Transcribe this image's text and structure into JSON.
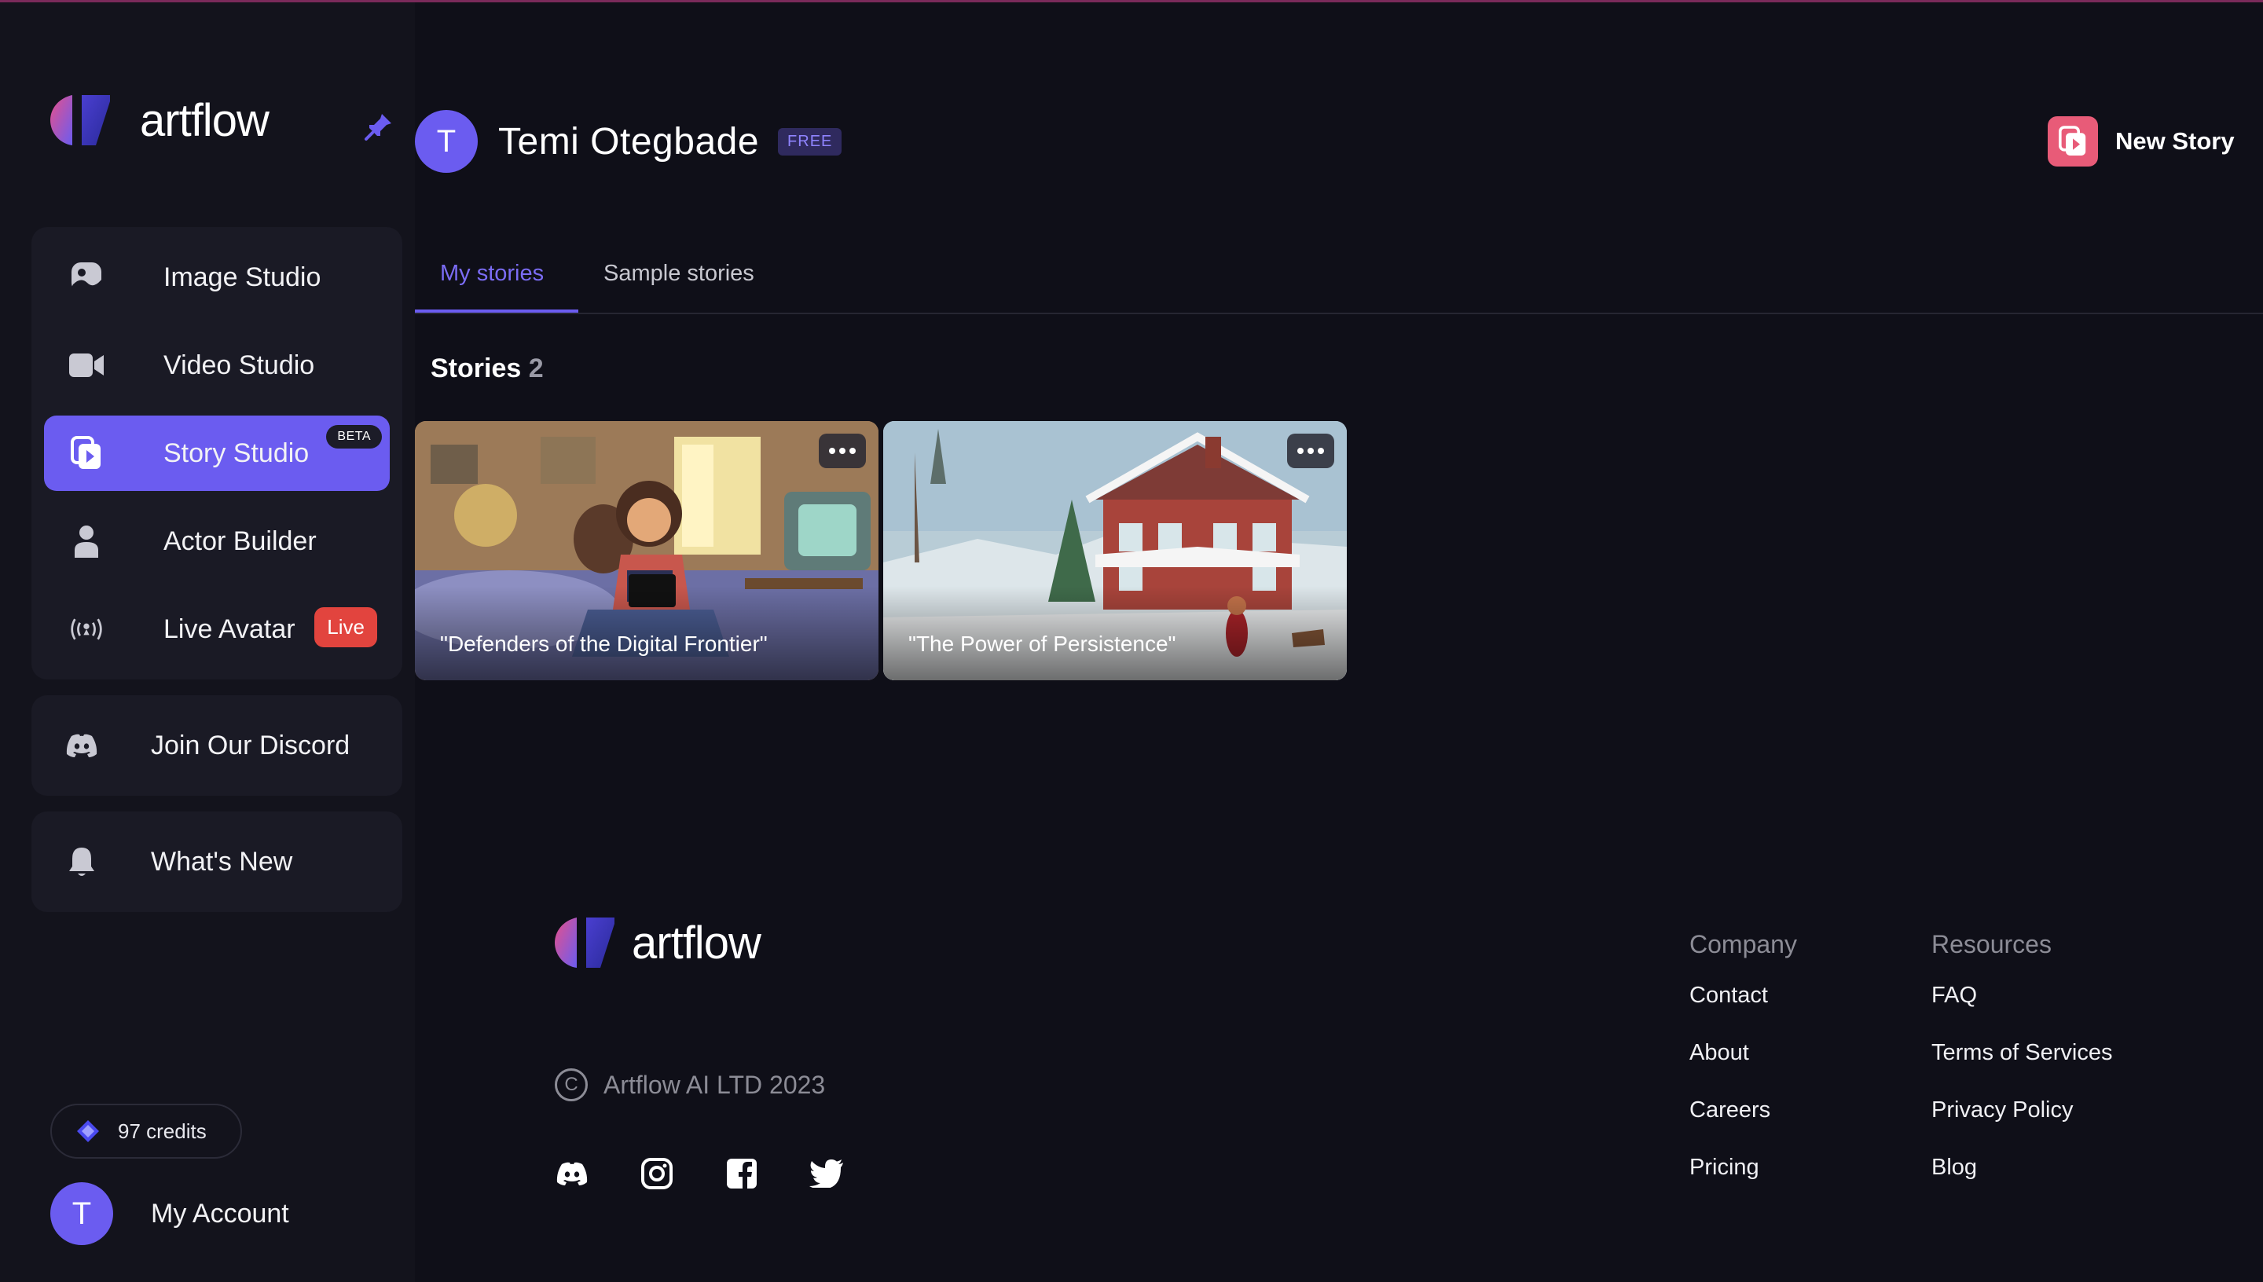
{
  "brand": {
    "name_prefix": "art",
    "name_suffix": "flow"
  },
  "sidebar": {
    "nav": [
      {
        "label": "Image Studio",
        "icon": "image-studio-icon"
      },
      {
        "label": "Video Studio",
        "icon": "video-camera-icon"
      },
      {
        "label": "Story Studio",
        "icon": "story-studio-icon",
        "badge": "BETA",
        "active": true
      },
      {
        "label": "Actor Builder",
        "icon": "person-icon"
      },
      {
        "label": "Live Avatar",
        "icon": "broadcast-icon",
        "badge": "Live"
      }
    ],
    "discord": {
      "label": "Join Our Discord",
      "icon": "discord-icon"
    },
    "whats_new": {
      "label": "What's New",
      "icon": "bell-icon"
    },
    "credits": "97 credits",
    "account": {
      "initial": "T",
      "label": "My Account"
    }
  },
  "header": {
    "user_initial": "T",
    "user_name": "Temi Otegbade",
    "plan": "FREE",
    "new_story_label": "New Story"
  },
  "tabs": [
    {
      "label": "My stories",
      "active": true
    },
    {
      "label": "Sample stories",
      "active": false
    }
  ],
  "stories": {
    "heading": "Stories",
    "count": "2",
    "items": [
      {
        "title": "\"Defenders of the Digital Frontier\""
      },
      {
        "title": "\"The Power of Persistence\""
      }
    ]
  },
  "footer": {
    "copyright": "Artflow AI LTD 2023",
    "copyright_symbol": "C",
    "company": {
      "heading": "Company",
      "links": [
        "Contact",
        "About",
        "Careers",
        "Pricing"
      ]
    },
    "resources": {
      "heading": "Resources",
      "links": [
        "FAQ",
        "Terms of Services",
        "Privacy Policy",
        "Blog"
      ]
    }
  },
  "colors": {
    "accent": "#6b5cf0",
    "live": "#e2443e",
    "new_story": "#e85b78",
    "background": "#0f0f18"
  }
}
